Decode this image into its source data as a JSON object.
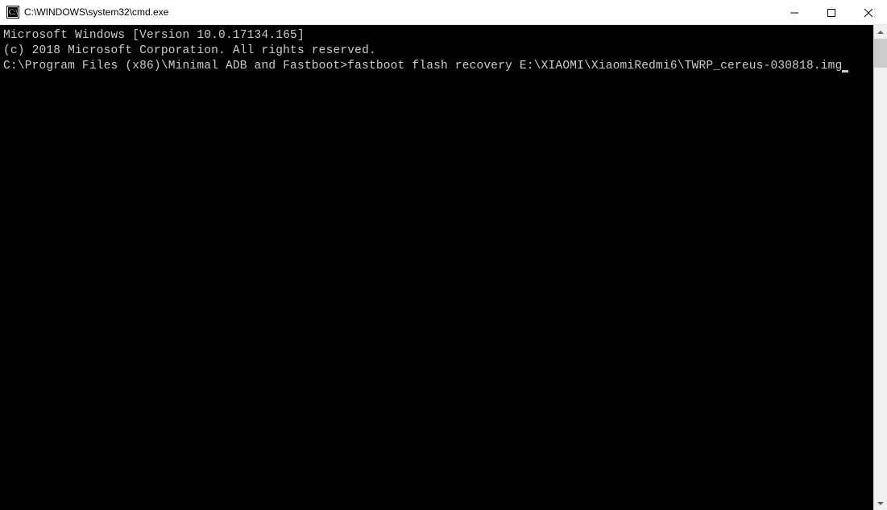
{
  "window": {
    "title": "C:\\WINDOWS\\system32\\cmd.exe"
  },
  "terminal": {
    "banner_line1": "Microsoft Windows [Version 10.0.17134.165]",
    "banner_line2": "(c) 2018 Microsoft Corporation. All rights reserved.",
    "blank": "",
    "prompt": "C:\\Program Files (x86)\\Minimal ADB and Fastboot>",
    "command": "fastboot flash recovery E:\\XIAOMI\\XiaomiRedmi6\\TWRP_cereus-030818.img"
  }
}
